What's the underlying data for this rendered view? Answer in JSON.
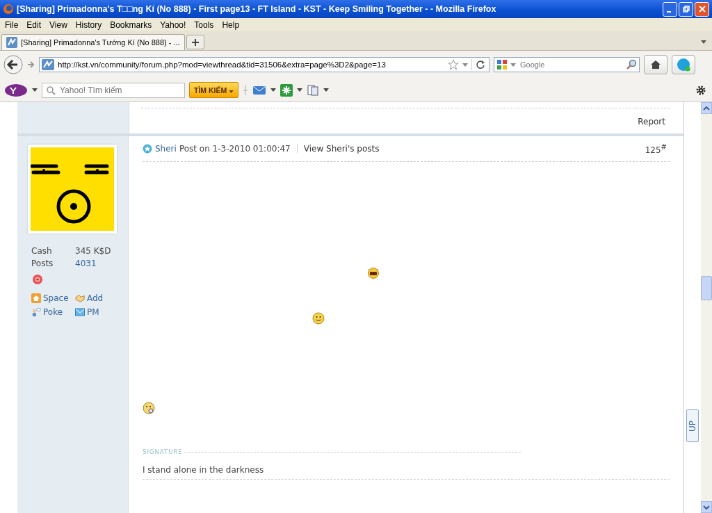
{
  "window": {
    "title": "[Sharing] Primadonna's T□□ng Kí (No 888) - First page13 - FT Island - KST - Keep Smiling Together - - Mozilla Firefox"
  },
  "menu": [
    "File",
    "Edit",
    "View",
    "History",
    "Bookmarks",
    "Yahoo!",
    "Tools",
    "Help"
  ],
  "tabs": [
    {
      "label": "[Sharing] Primadonna's Tướng Kí (No 888) - ...",
      "selected": true
    }
  ],
  "address": {
    "value": "http://kst.vn/community/forum.php?mod=viewthread&tid=31506&extra=page%3D2&page=13"
  },
  "search": {
    "placeholder": "Google"
  },
  "yahoo_toolbar": {
    "placeholder": "Yahoo! Tìm kiếm",
    "button": "TÌM KIẾM"
  },
  "previous_post": {
    "report": "Report"
  },
  "post": {
    "author": "Sheri",
    "posted": "Post on 1-3-2010 01:00:47",
    "view_posts": "View Sheri's posts",
    "number": "125$^{#}$",
    "stats": [
      {
        "label": "Cash",
        "value": "345 K$D"
      },
      {
        "label": "Posts",
        "value": "4031"
      }
    ],
    "actions": [
      {
        "kind": "space",
        "label": "Space"
      },
      {
        "kind": "add",
        "label": "Add"
      },
      {
        "kind": "poke",
        "label": "Poke"
      },
      {
        "kind": "pm",
        "label": "PM"
      }
    ],
    "signature_heading": "SIGNATURE",
    "signature": "I stand alone in the darkness"
  },
  "back_to_top": "UP"
}
